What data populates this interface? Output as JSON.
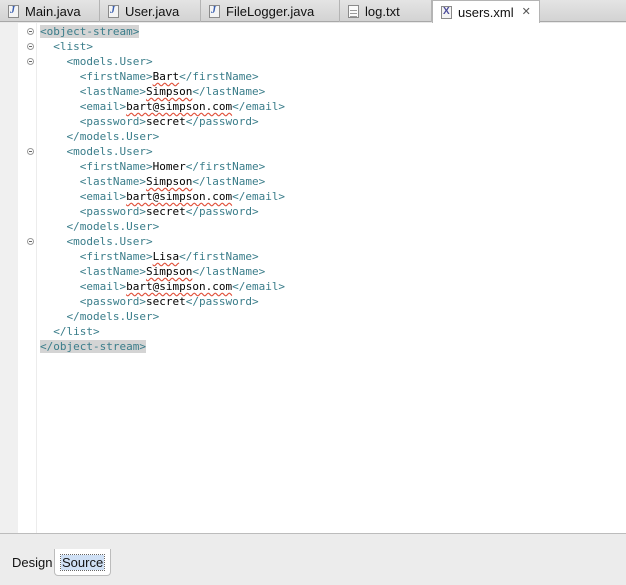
{
  "tabs": [
    {
      "label": "Main.java",
      "icon": "java-file-icon"
    },
    {
      "label": "User.java",
      "icon": "java-file-icon"
    },
    {
      "label": "FileLogger.java",
      "icon": "java-file-icon"
    },
    {
      "label": "log.txt",
      "icon": "text-file-icon"
    },
    {
      "label": "users.xml",
      "icon": "xml-file-icon",
      "active": true,
      "close_icon": "close-icon"
    }
  ],
  "editor": {
    "root_open": "<object-stream>",
    "list_open": "<list>",
    "users": [
      {
        "open": "<models.User>",
        "firstName": "Bart",
        "lastName": "Simpson",
        "email": "bart@simpson.com",
        "password": "secret",
        "close": "</models.User>"
      },
      {
        "open": "<models.User>",
        "firstName": "Homer",
        "lastName": "Simpson",
        "email": "bart@simpson.com",
        "password": "secret",
        "close": "</models.User>"
      },
      {
        "open": "<models.User>",
        "firstName": "Lisa",
        "lastName": "Simpson",
        "email": "bart@simpson.com",
        "password": "secret",
        "close": "</models.User>"
      }
    ],
    "tags": {
      "firstName_open": "<firstName>",
      "firstName_close": "</firstName>",
      "lastName_open": "<lastName>",
      "lastName_close": "</lastName>",
      "email_open": "<email>",
      "email_close": "</email>",
      "password_open": "<password>",
      "password_close": "</password>"
    },
    "list_close": "</list>",
    "root_close": "</object-stream>",
    "colors": {
      "tag": "#3a7d8a",
      "text": "#000000",
      "spelling": "#e0503a",
      "match_highlight": "#d4d4d4"
    }
  },
  "bottom_tabs": [
    {
      "label": "Design"
    },
    {
      "label": "Source",
      "active": true
    }
  ]
}
